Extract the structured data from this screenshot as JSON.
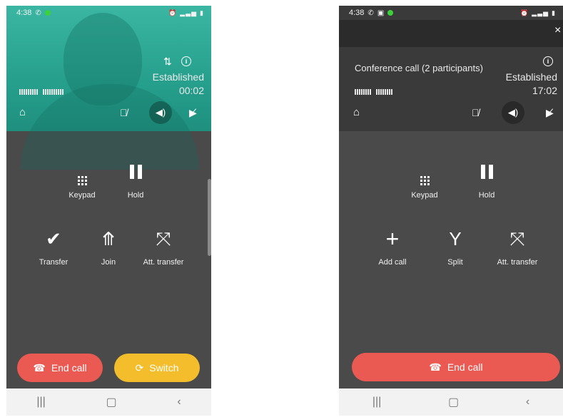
{
  "left": {
    "status_bar": {
      "time": "4:38"
    },
    "header": {
      "status": "Established",
      "timer": "00:02"
    },
    "actions": [
      {
        "label": "Keypad"
      },
      {
        "label": "Hold"
      },
      {
        "label": "Transfer"
      },
      {
        "label": "Join"
      },
      {
        "label": "Att. transfer"
      }
    ],
    "end_call_label": "End call",
    "switch_label": "Switch"
  },
  "right": {
    "status_bar": {
      "time": "4:38"
    },
    "header": {
      "title": "Conference call (2 participants)",
      "status": "Established",
      "timer": "17:02"
    },
    "actions": [
      {
        "label": "Keypad"
      },
      {
        "label": "Hold"
      },
      {
        "label": "Add call"
      },
      {
        "label": "Split"
      },
      {
        "label": "Att. transfer"
      }
    ],
    "end_call_label": "End call"
  },
  "colors": {
    "teal": "#26a08d",
    "end_call": "#ea5a52",
    "switch": "#f4bd2c",
    "background": "#4a4a4a"
  },
  "icons": [
    "phone-icon",
    "home-icon",
    "mute-icon",
    "speaker-icon",
    "video-off-icon",
    "info-icon",
    "close-icon"
  ]
}
